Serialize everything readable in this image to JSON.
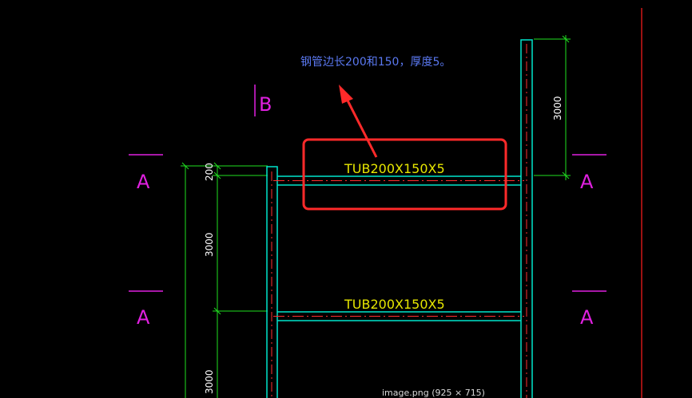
{
  "annotation": {
    "note": "钢管边长200和150，厚度5。",
    "color": "#5a78f0"
  },
  "labels": {
    "section_b": "B",
    "section_a": "A",
    "beam_top": "TUB200X150X5",
    "beam_mid": "TUB200X150X5"
  },
  "dimensions": {
    "right_top": "3000",
    "left_small": "200",
    "left_mid": "3000",
    "left_bottom": "3000"
  },
  "footer": {
    "caption": "image.png (925 × 715)"
  },
  "colors": {
    "background": "#000000",
    "steel": "#00e5cc",
    "centerline": "#ff3030",
    "dimension": "#20e020",
    "section_mark": "#e020e0",
    "beam_text": "#e6e600",
    "highlight": "#ff2a2a"
  }
}
